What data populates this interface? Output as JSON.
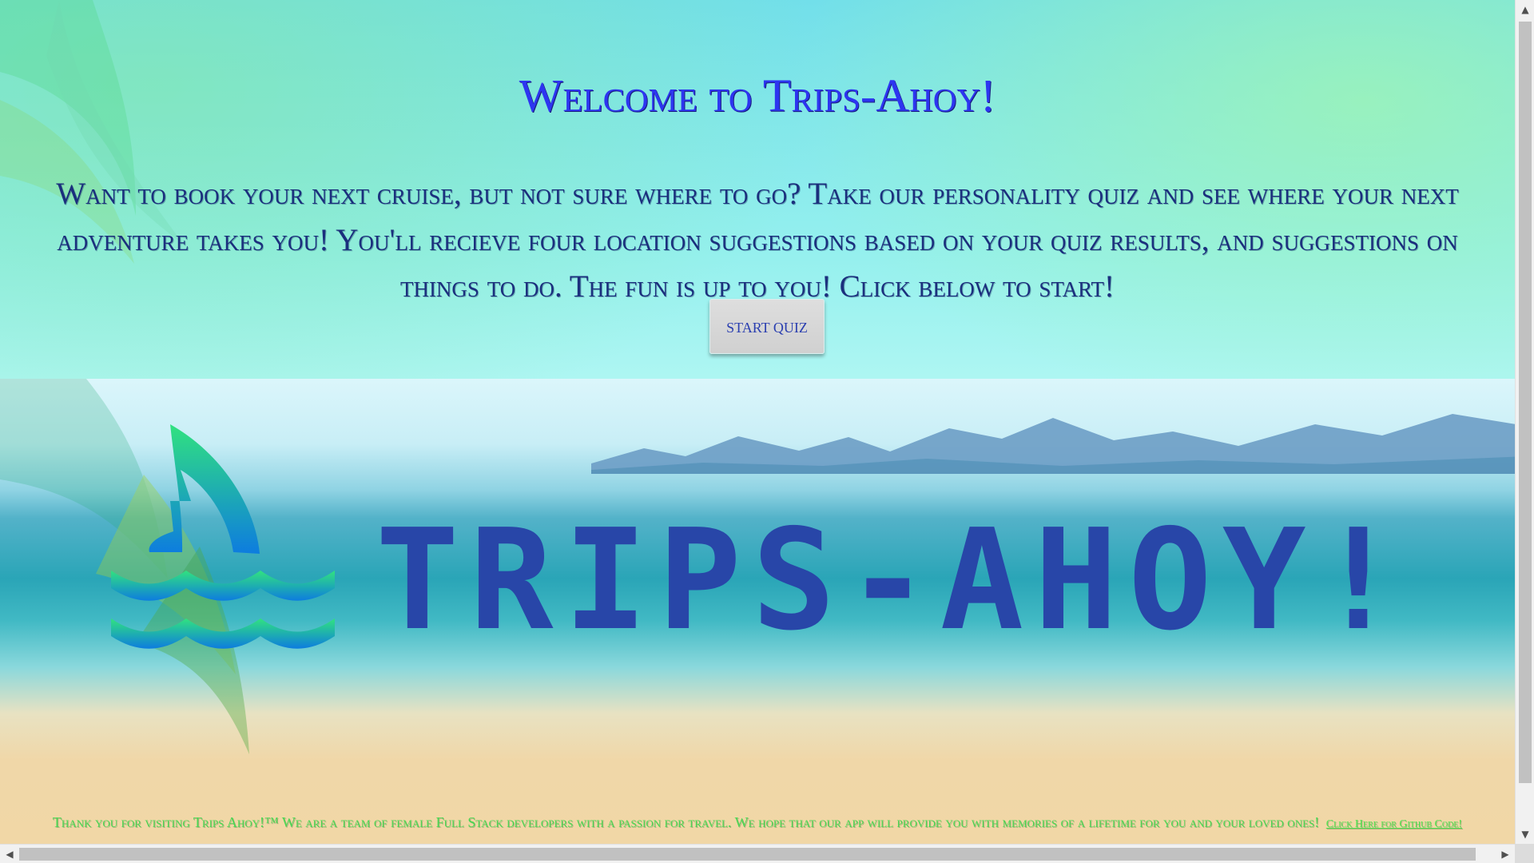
{
  "hero": {
    "title": "Welcome to Trips-Ahoy!",
    "intro": "Want to book your next cruise, but not sure where to go? Take our personality quiz and see where your next adventure takes you! You'll recieve four location suggestions based on your quiz results, and suggestions on things to do. The fun is up to you! Click below to start!",
    "button_label": "START QUIZ"
  },
  "brand": {
    "name": "TRIPS-AHOY!",
    "logo_icon": "shark-fin-waves-icon"
  },
  "footer": {
    "message": "Thank you for visiting Trips Ahoy!™ We are a team of female Full Stack developers with a passion for travel. We hope that our app will provide you with memories of a lifetime for you and your loved ones!",
    "link_text": "Click Here for Github Code!"
  },
  "scrollbars": {
    "up_icon": "scroll-up-icon",
    "down_icon": "scroll-down-icon",
    "left_icon": "scroll-left-icon",
    "right_icon": "scroll-right-icon"
  },
  "colors": {
    "title": "#2d35f0",
    "intro": "#1b2f7d",
    "button_bg": "#d8d8d8",
    "brand_text": "#2846a8",
    "footer_text": "#49d852",
    "logo_gradient_top": "#31e27f",
    "logo_gradient_bottom": "#0d7cdf"
  }
}
